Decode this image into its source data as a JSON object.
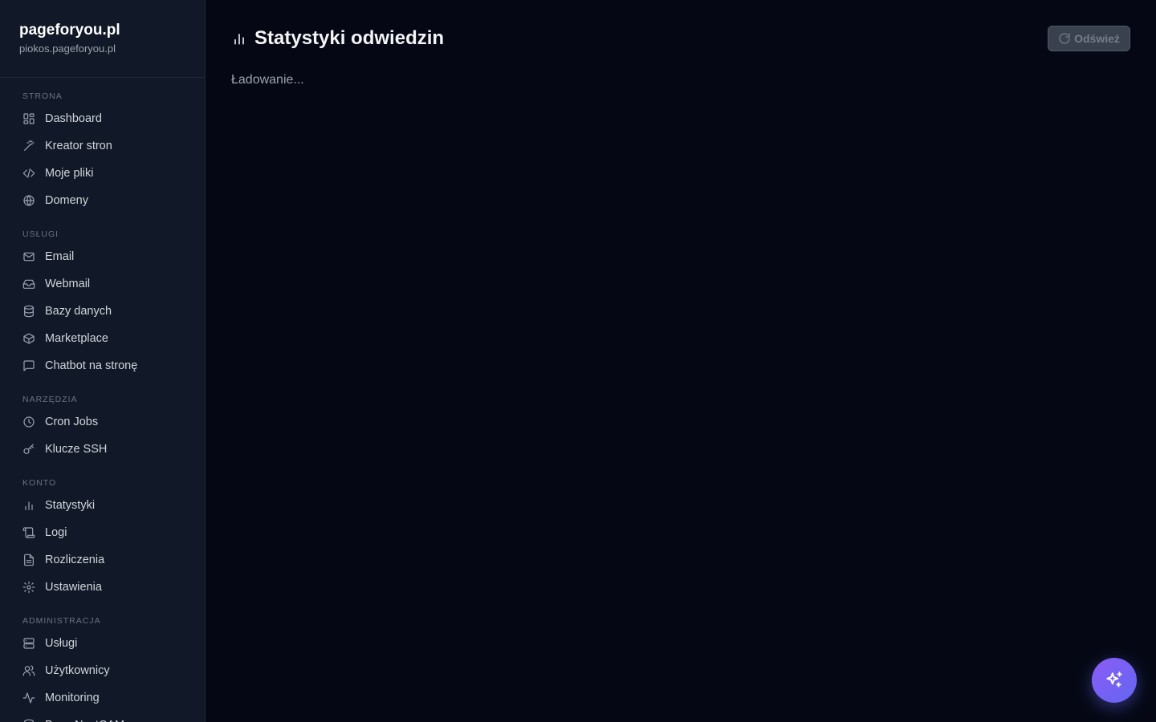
{
  "brand": {
    "title": "pageforyou.pl",
    "subtitle": "piokos.pageforyou.pl"
  },
  "sidebar": {
    "sections": [
      {
        "label": "STRONA",
        "items": [
          {
            "label": "Dashboard",
            "icon": "dashboard-icon"
          },
          {
            "label": "Kreator stron",
            "icon": "magic-wand-icon"
          },
          {
            "label": "Moje pliki",
            "icon": "code-icon"
          },
          {
            "label": "Domeny",
            "icon": "globe-icon"
          }
        ]
      },
      {
        "label": "USŁUGI",
        "items": [
          {
            "label": "Email",
            "icon": "mail-icon"
          },
          {
            "label": "Webmail",
            "icon": "inbox-icon"
          },
          {
            "label": "Bazy danych",
            "icon": "database-icon"
          },
          {
            "label": "Marketplace",
            "icon": "package-icon"
          },
          {
            "label": "Chatbot na stronę",
            "icon": "chat-icon"
          }
        ]
      },
      {
        "label": "NARZĘDZIA",
        "items": [
          {
            "label": "Cron Jobs",
            "icon": "clock-icon"
          },
          {
            "label": "Klucze SSH",
            "icon": "key-icon"
          }
        ]
      },
      {
        "label": "KONTO",
        "items": [
          {
            "label": "Statystyki",
            "icon": "bar-chart-icon"
          },
          {
            "label": "Logi",
            "icon": "scroll-icon"
          },
          {
            "label": "Rozliczenia",
            "icon": "file-text-icon"
          },
          {
            "label": "Ustawienia",
            "icon": "gear-icon"
          }
        ]
      },
      {
        "label": "ADMINISTRACJA",
        "items": [
          {
            "label": "Usługi",
            "icon": "server-icon"
          },
          {
            "label": "Użytkownicy",
            "icon": "users-icon"
          },
          {
            "label": "Monitoring",
            "icon": "activity-icon"
          },
          {
            "label": "Baza NextCAM",
            "icon": "database-icon"
          }
        ]
      }
    ]
  },
  "main": {
    "title": "Statystyki odwiedzin",
    "title_icon": "bar-chart-icon",
    "refresh_label": "Odśwież",
    "refresh_icon": "refresh-icon",
    "loading_text": "Ładowanie..."
  },
  "fab": {
    "icon": "sparkles-icon"
  },
  "colors": {
    "background": "#050814",
    "sidebar": "#111827",
    "accent_start": "#8b5cf6",
    "accent_end": "#6366f1"
  }
}
